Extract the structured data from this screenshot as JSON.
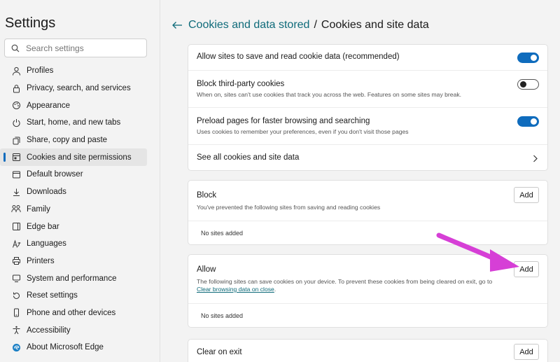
{
  "sidebar": {
    "title": "Settings",
    "search_placeholder": "Search settings",
    "items": [
      {
        "label": "Profiles",
        "icon": "profile-icon"
      },
      {
        "label": "Privacy, search, and services",
        "icon": "lock-icon"
      },
      {
        "label": "Appearance",
        "icon": "appearance-icon"
      },
      {
        "label": "Start, home, and new tabs",
        "icon": "power-icon"
      },
      {
        "label": "Share, copy and paste",
        "icon": "share-icon"
      },
      {
        "label": "Cookies and site permissions",
        "icon": "cookies-icon",
        "active": true
      },
      {
        "label": "Default browser",
        "icon": "browser-icon"
      },
      {
        "label": "Downloads",
        "icon": "download-icon"
      },
      {
        "label": "Family",
        "icon": "family-icon"
      },
      {
        "label": "Edge bar",
        "icon": "edge-bar-icon"
      },
      {
        "label": "Languages",
        "icon": "languages-icon"
      },
      {
        "label": "Printers",
        "icon": "printer-icon"
      },
      {
        "label": "System and performance",
        "icon": "system-icon"
      },
      {
        "label": "Reset settings",
        "icon": "reset-icon"
      },
      {
        "label": "Phone and other devices",
        "icon": "phone-icon"
      },
      {
        "label": "Accessibility",
        "icon": "accessibility-icon"
      },
      {
        "label": "About Microsoft Edge",
        "icon": "edge-icon"
      }
    ]
  },
  "breadcrumb": {
    "parent": "Cookies and data stored",
    "separator": "/",
    "current": "Cookies and site data"
  },
  "settings": {
    "allow_cookies": {
      "label": "Allow sites to save and read cookie data (recommended)",
      "enabled": true
    },
    "block_third_party": {
      "label": "Block third-party cookies",
      "description": "When on, sites can't use cookies that track you across the web. Features on some sites may break.",
      "enabled": false
    },
    "preload": {
      "label": "Preload pages for faster browsing and searching",
      "description": "Uses cookies to remember your preferences, even if you don't visit those pages",
      "enabled": true
    },
    "see_all": {
      "label": "See all cookies and site data"
    }
  },
  "block": {
    "title": "Block",
    "description": "You've prevented the following sites from saving and reading cookies",
    "add_label": "Add",
    "empty": "No sites added"
  },
  "allow": {
    "title": "Allow",
    "description": "The following sites can save cookies on your device. To prevent these cookies from being cleared on exit, go to",
    "link": "Clear browsing data on close",
    "link_suffix": ".",
    "add_label": "Add",
    "empty": "No sites added"
  },
  "clear_on_exit": {
    "title": "Clear on exit",
    "add_label": "Add"
  },
  "colors": {
    "accent": "#0f6cbd",
    "link": "#0f6b7a",
    "annotation_arrow": "#d63fd6"
  }
}
